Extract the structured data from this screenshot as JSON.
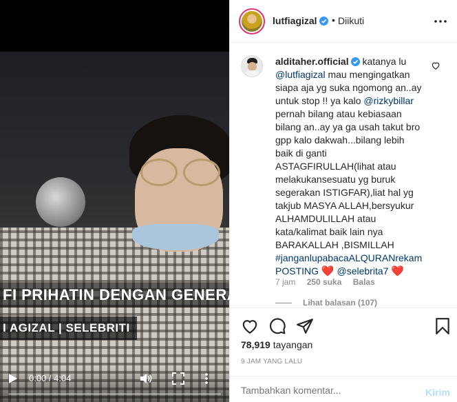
{
  "video": {
    "caption": "FI PRIHATIN DENGAN GENERASI KIDS JA",
    "subcaption": "I AGIZAL | SELEBRITI",
    "time": "0:00 / 4:04",
    "progress": 0.0
  },
  "header": {
    "username": "lutfiagizal",
    "separator": "•",
    "follow_status": "Diikuti"
  },
  "comment": {
    "username": "alditaher.official",
    "segments": [
      {
        "type": "text",
        "value": " katanya lu "
      },
      {
        "type": "tag",
        "value": "@lutfiagizal"
      },
      {
        "type": "text",
        "value": " mau mengingatkan siapa aja yg suka ngomong an..ay untuk stop !! ya kalo "
      },
      {
        "type": "tag",
        "value": "@rizkybillar"
      },
      {
        "type": "text",
        "value": " pernah bilang atau kebiasaan bilang an..ay ya ga usah takut bro gpp kalo dakwah...bilang lebih baik di ganti ASTAGFIRULLAH(lihat atau melakukansesuatu yg buruk segerakan ISTIGFAR),liat hal yg takjub MASYA ALLAH,bersyukur ALHAMDULILLAH atau kata/kalimat baik lain nya BARAKALLAH ,BISMILLAH "
      },
      {
        "type": "tag",
        "value": "#janganlupabacaALQURANrekam"
      },
      {
        "type": "text",
        "value": " "
      },
      {
        "type": "tag",
        "value": "POSTING"
      },
      {
        "type": "text",
        "value": " "
      },
      {
        "type": "heart",
        "value": "❤️"
      },
      {
        "type": "text",
        "value": " "
      },
      {
        "type": "tag",
        "value": "@selebrita7"
      },
      {
        "type": "text",
        "value": " "
      },
      {
        "type": "heart",
        "value": "❤️"
      }
    ],
    "time": "7 jam",
    "likes": "250 suka",
    "reply": "Balas",
    "view_replies": "Lihat balasan (107)"
  },
  "stats": {
    "views": "78,919",
    "views_label": "tayangan",
    "timestamp": "9 JAM YANG LALU"
  },
  "add_comment": {
    "placeholder": "Tambahkan komentar...",
    "send_label": "Kirim"
  },
  "colors": {
    "link": "#00376b",
    "muted": "#8e8e8e",
    "verified": "#3897f0",
    "heart": "#ed4956",
    "send_disabled": "#b2dffc"
  }
}
